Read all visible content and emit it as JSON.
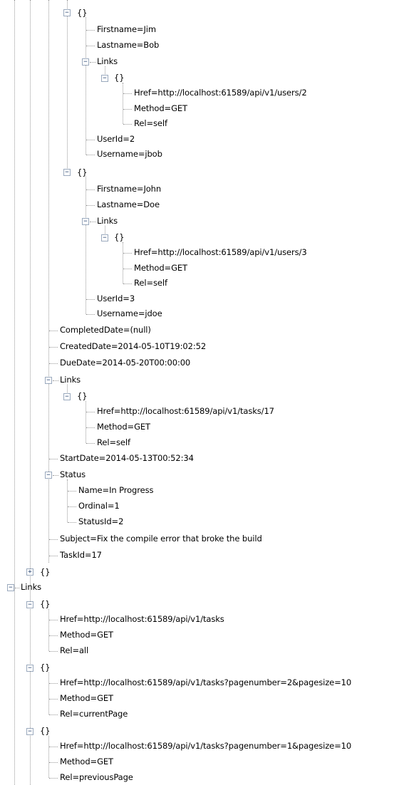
{
  "tree": {
    "users": [
      {
        "firstname": "Firstname=Jim",
        "lastname": "Lastname=Bob",
        "links_label": "Links",
        "href": "Href=http://localhost:61589/api/v1/users/2",
        "method": "Method=GET",
        "rel": "Rel=self",
        "user_id": "UserId=2",
        "username": "Username=jbob"
      },
      {
        "firstname": "Firstname=John",
        "lastname": "Lastname=Doe",
        "links_label": "Links",
        "href": "Href=http://localhost:61589/api/v1/users/3",
        "method": "Method=GET",
        "rel": "Rel=self",
        "user_id": "UserId=3",
        "username": "Username=jdoe"
      }
    ],
    "task": {
      "completed_date": "CompletedDate=(null)",
      "created_date": "CreatedDate=2014-05-10T19:02:52",
      "due_date": "DueDate=2014-05-20T00:00:00",
      "links_label": "Links",
      "href": "Href=http://localhost:61589/api/v1/tasks/17",
      "method": "Method=GET",
      "rel": "Rel=self",
      "start_date": "StartDate=2014-05-13T00:52:34",
      "status_label": "Status",
      "status_name": "Name=In Progress",
      "status_ordinal": "Ordinal=1",
      "status_id": "StatusId=2",
      "subject": "Subject=Fix the compile error that broke the build",
      "task_id": "TaskId=17"
    },
    "object_node": "{}",
    "links_label": "Links",
    "links": [
      {
        "href": "Href=http://localhost:61589/api/v1/tasks",
        "method": "Method=GET",
        "rel": "Rel=all"
      },
      {
        "href": "Href=http://localhost:61589/api/v1/tasks?pagenumber=2&pagesize=10",
        "method": "Method=GET",
        "rel": "Rel=currentPage"
      },
      {
        "href": "Href=http://localhost:61589/api/v1/tasks?pagenumber=1&pagesize=10",
        "method": "Method=GET",
        "rel": "Rel=previousPage"
      }
    ],
    "glyphs": {
      "expanded": "−",
      "collapsed": "+"
    },
    "colors": {
      "connector": "#9a9a9a",
      "box_border": "#9aa9bd",
      "box_glyph": "#1e3d6b",
      "background": "#ffffff"
    }
  }
}
